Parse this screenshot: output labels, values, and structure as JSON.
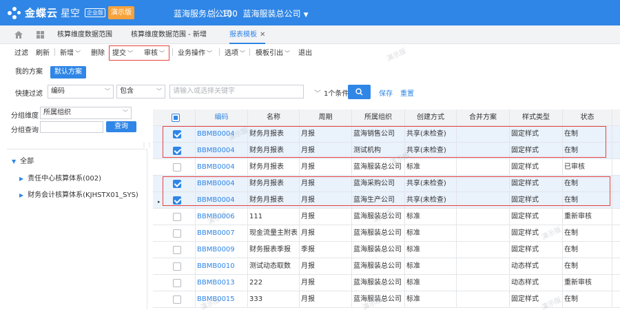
{
  "app": {
    "brand": "金蝶云",
    "product": "星空",
    "edition": "企业版",
    "demo_label": "演示版",
    "org": "蓝海服务总公司",
    "tenant_id": "100",
    "tenant_name": "蓝海服装总公司"
  },
  "tabs": [
    {
      "label": "核算维度数据范围"
    },
    {
      "label": "核算维度数据范围 - 新增"
    },
    {
      "label": "报表模板"
    }
  ],
  "toolbar": {
    "filter": "过滤",
    "refresh": "刷新",
    "new": "新增",
    "delete": "删除",
    "submit": "提交",
    "audit": "审核",
    "business_ops": "业务操作",
    "options": "选项",
    "template_import": "模板引出",
    "exit": "退出"
  },
  "scheme": {
    "my_scheme": "我的方案",
    "default_scheme": "默认方案"
  },
  "quick_filter": {
    "label": "快捷过滤",
    "field": "编码",
    "operator": "包含",
    "placeholder": "请输入或选择关键字",
    "condition_count": "1个条件",
    "save": "保存",
    "reset": "重置"
  },
  "left_panel": {
    "group_dimension_label": "分组维度",
    "group_dimension_value": "所属组织",
    "group_query_label": "分组查询",
    "query_button": "查询",
    "tree": {
      "root": "全部",
      "children": [
        "责任中心核算体系(002)",
        "财务会计核算体系(KJHSTX01_SYS)"
      ]
    }
  },
  "grid": {
    "columns": [
      "编码",
      "名称",
      "周期",
      "所属组织",
      "创建方式",
      "合并方案",
      "样式类型",
      "状态"
    ],
    "rows": [
      {
        "checked": true,
        "code": "BBMB0004",
        "name": "财务月报表",
        "period": "月报",
        "org": "蓝海销售公司",
        "method": "共享(未检查)",
        "merge": "",
        "style": "固定样式",
        "status": "在制"
      },
      {
        "checked": true,
        "code": "BBMB0004",
        "name": "财务月报表",
        "period": "月报",
        "org": "测试机构",
        "method": "共享(未检查)",
        "merge": "",
        "style": "固定样式",
        "status": "在制"
      },
      {
        "checked": false,
        "code": "BBMB0004",
        "name": "财务月报表",
        "period": "月报",
        "org": "蓝海服装总公司",
        "method": "标准",
        "merge": "",
        "style": "固定样式",
        "status": "已审核"
      },
      {
        "checked": true,
        "code": "BBMB0004",
        "name": "财务月报表",
        "period": "月报",
        "org": "蓝海采购公司",
        "method": "共享(未检查)",
        "merge": "",
        "style": "固定样式",
        "status": "在制"
      },
      {
        "checked": true,
        "code": "BBMB0004",
        "name": "财务月报表",
        "period": "月报",
        "org": "蓝海生产公司",
        "method": "共享(未检查)",
        "merge": "",
        "style": "固定样式",
        "status": "在制"
      },
      {
        "checked": false,
        "code": "BBMB0006",
        "name": "111",
        "period": "月报",
        "org": "蓝海服装总公司",
        "method": "标准",
        "merge": "",
        "style": "固定样式",
        "status": "重新审核"
      },
      {
        "checked": false,
        "code": "BBMB0007",
        "name": "现金流量主附表",
        "period": "月报",
        "org": "蓝海服装总公司",
        "method": "标准",
        "merge": "",
        "style": "固定样式",
        "status": "在制"
      },
      {
        "checked": false,
        "code": "BBMB0009",
        "name": "财务报表季报",
        "period": "季报",
        "org": "蓝海服装总公司",
        "method": "标准",
        "merge": "",
        "style": "固定样式",
        "status": "在制"
      },
      {
        "checked": false,
        "code": "BBMB0010",
        "name": "测试动态取数",
        "period": "月报",
        "org": "蓝海服装总公司",
        "method": "标准",
        "merge": "",
        "style": "动态样式",
        "status": "在制"
      },
      {
        "checked": false,
        "code": "BBMB0013",
        "name": "222",
        "period": "月报",
        "org": "蓝海服装总公司",
        "method": "标准",
        "merge": "",
        "style": "动态样式",
        "status": "重新审核"
      },
      {
        "checked": false,
        "code": "BBMB0015",
        "name": "333",
        "period": "月报",
        "org": "蓝海服装总公司",
        "method": "标准",
        "merge": "",
        "style": "固定样式",
        "status": "在制"
      }
    ]
  },
  "watermark": "演示版",
  "colors": {
    "brand_blue": "#2f86e6",
    "demo_orange": "#f7a23b",
    "highlight_red": "#e5413e"
  }
}
